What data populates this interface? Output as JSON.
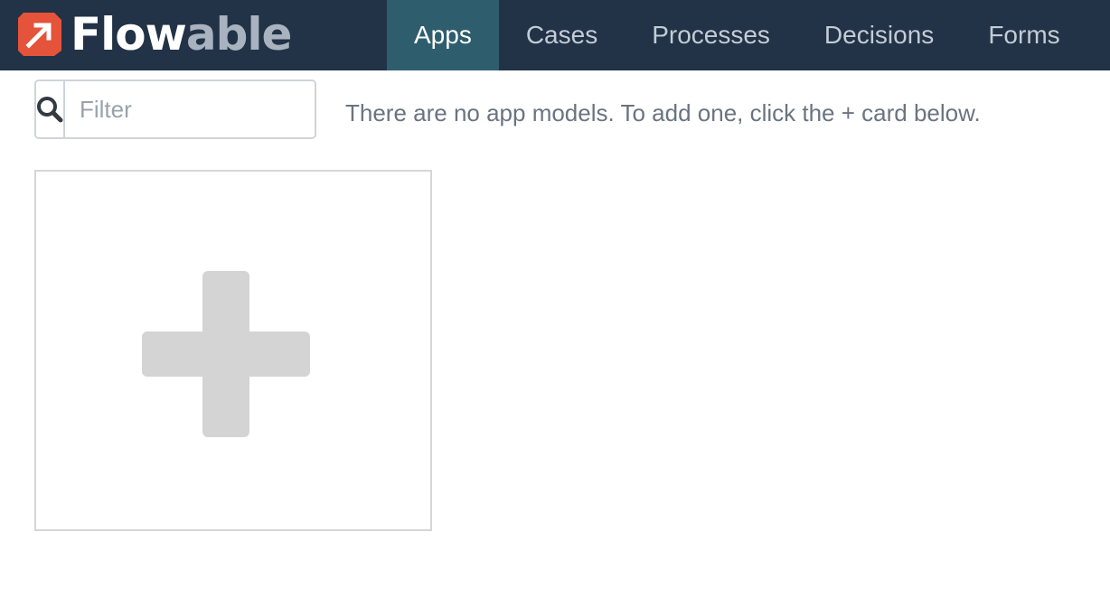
{
  "brand": {
    "name_main": "Flow",
    "name_accent": "able",
    "logo_color": "#e4533a"
  },
  "nav": {
    "tabs": [
      {
        "label": "Apps",
        "active": true
      },
      {
        "label": "Cases",
        "active": false
      },
      {
        "label": "Processes",
        "active": false
      },
      {
        "label": "Decisions",
        "active": false
      },
      {
        "label": "Forms",
        "active": false
      }
    ]
  },
  "filter": {
    "placeholder": "Filter",
    "value": "",
    "icon": "search-icon"
  },
  "message": "There are no app models. To add one, click the + card below.",
  "add_card": {
    "icon": "plus-icon"
  },
  "colors": {
    "navbar_bg": "#223247",
    "active_tab_bg": "#2e5e6e",
    "plus_color": "#d4d4d4"
  }
}
